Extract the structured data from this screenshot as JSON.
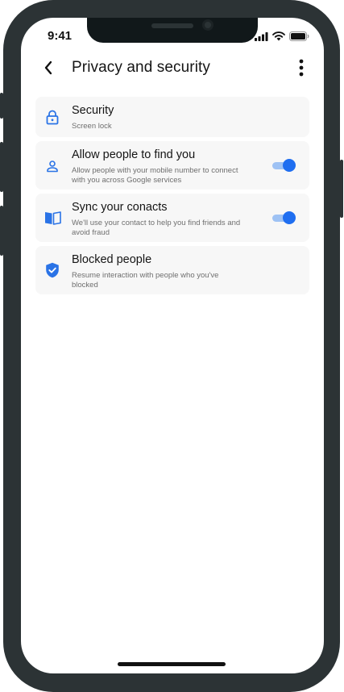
{
  "status_bar": {
    "time": "9:41",
    "icons": [
      "cellular-signal-icon",
      "wifi-icon",
      "battery-icon"
    ]
  },
  "header": {
    "title": "Privacy and security",
    "back_icon": "chevron-left-icon",
    "more_icon": "more-vertical-icon"
  },
  "settings": [
    {
      "icon": "lock-icon",
      "title": "Security",
      "description": "Screen lock",
      "has_toggle": false
    },
    {
      "icon": "person-icon",
      "title": "Allow people to find you",
      "description": "Allow people with your mobile number to connect with you across Google services",
      "has_toggle": true,
      "toggle_on": true
    },
    {
      "icon": "book-icon",
      "title": "Sync your conacts",
      "description": "We'll use your contact to help you find friends and avoid fraud",
      "has_toggle": true,
      "toggle_on": true
    },
    {
      "icon": "shield-check-icon",
      "title": "Blocked people",
      "description": "Resume interaction with people who you've blocked",
      "has_toggle": false
    }
  ],
  "colors": {
    "accent": "#1f6ef0",
    "toggle_track": "#9ec2f4",
    "row_background": "#f7f7f7",
    "frame": "#2c3335"
  }
}
